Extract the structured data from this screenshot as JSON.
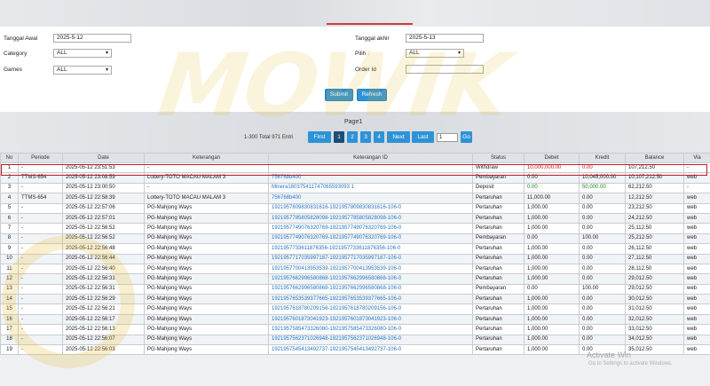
{
  "filters": {
    "tanggal_awal_label": "Tanggal Awal",
    "tanggal_awal_value": "2025-5-12",
    "tanggal_akhir_label": "Tanggal akhir",
    "tanggal_akhir_value": "2025-5-13",
    "category_label": "Category",
    "category_value": "ALL",
    "pilih_label": "Pilih :",
    "pilih_value": "ALL",
    "games_label": "Games",
    "games_value": "ALL",
    "order_id_label": "Order Id",
    "order_id_value": "",
    "submit_label": "Submit",
    "refresh_label": "Refresh"
  },
  "pager": {
    "page_title": "Page1",
    "total_text": "1-300 Total 971 Entri",
    "first_label": "First",
    "pages": [
      "1",
      "2",
      "3",
      "4"
    ],
    "next_label": "Next",
    "last_label": "Last",
    "goto_value": "1",
    "go_label": "Go"
  },
  "table": {
    "headers": [
      "No",
      "Periode",
      "Date",
      "Keterangan",
      "Keterangan ID",
      "Status",
      "Debet",
      "Kredit",
      "Balance",
      "Via"
    ],
    "rows": [
      [
        "1",
        "-",
        "2025-05-12 23:51:53",
        "-",
        "",
        "Withdraw",
        "10,000,000.00",
        "0.00",
        "107,212.50",
        "-"
      ],
      [
        "2",
        "TTMS-654",
        "2025-05-12 23:08:59",
        "Lottery-TOTO MACAU MALAM 3",
        "756768b400",
        "Pembayaran",
        "0.00",
        "10,045,000.00",
        "10,107,212.50",
        "web"
      ],
      [
        "3",
        "-",
        "2025-05-12 23:00:50",
        "-",
        "Minera180375411747065593093 1",
        "Deposit",
        "0.00",
        "50,000.00",
        "62,212.50",
        "-"
      ],
      [
        "4",
        "TTMS-654",
        "2025-05-12 22:58:39",
        "Lottery-TOTO MACAU MALAM 3",
        "756768b400",
        "Pertaruhan",
        "11,000.00",
        "0.00",
        "12,212.50",
        "web"
      ],
      [
        "5",
        "-",
        "2025-05-12 22:57:06",
        "PG-Mahjong Ways",
        "1921957809830831616-1921957809830831616-106-0",
        "Pertaruhan",
        "1,000.00",
        "0.00",
        "23,212.50",
        "web"
      ],
      [
        "6",
        "-",
        "2025-05-12 22:57:01",
        "PG-Mahjong Ways",
        "1921957785805828098-1921957785805828098-106-0",
        "Pertaruhan",
        "1,000.00",
        "0.00",
        "24,212.50",
        "web"
      ],
      [
        "7",
        "-",
        "2025-05-12 22:56:52",
        "PG-Mahjong Ways",
        "1921957749076320769-1921957749076320769-106-0",
        "Pertaruhan",
        "1,000.00",
        "0.00",
        "25,112.50",
        "web"
      ],
      [
        "8",
        "-",
        "2025-05-12 22:56:52",
        "PG-Mahjong Ways",
        "1921957749076320769-1921957749076320769-106-0",
        "Pembayaran",
        "0.00",
        "100.00",
        "25,212.50",
        "web"
      ],
      [
        "9",
        "-",
        "2025-05-12 22:56:48",
        "PG-Mahjong Ways",
        "1921957733611876356-1921957733611876356-106-0",
        "Pertaruhan",
        "1,000.00",
        "0.00",
        "26,112.50",
        "web"
      ],
      [
        "10",
        "-",
        "2025-05-12 22:56:44",
        "PG-Mahjong Ways",
        "1921957717035997187-1921957717035997187-106-0",
        "Pertaruhan",
        "1,000.00",
        "0.00",
        "27,112.50",
        "web"
      ],
      [
        "11",
        "-",
        "2025-05-12 22:56:40",
        "PG-Mahjong Ways",
        "1921957700413953539-1921957700413953539-106-0",
        "Pertaruhan",
        "1,000.00",
        "0.00",
        "28,112.50",
        "web"
      ],
      [
        "12",
        "-",
        "2025-05-12 22:56:31",
        "PG-Mahjong Ways",
        "1921957662996580868-1921957662996580868-106-0",
        "Pertaruhan",
        "1,000.00",
        "0.00",
        "29,012.50",
        "web"
      ],
      [
        "13",
        "-",
        "2025-05-12 22:56:31",
        "PG-Mahjong Ways",
        "1921957662996580868-1921957662996580868-106-0",
        "Pembayaran",
        "0.00",
        "100.00",
        "29,012.50",
        "web"
      ],
      [
        "14",
        "-",
        "2025-05-12 22:56:29",
        "PG-Mahjong Ways",
        "1921957653539377665-1921957653539377665-106-0",
        "Pertaruhan",
        "1,000.00",
        "0.00",
        "30,012.50",
        "web"
      ],
      [
        "15",
        "-",
        "2025-05-12 22:56:21",
        "PG-Mahjong Ways",
        "1921957618780209156-1921957618780209156-106-0",
        "Pertaruhan",
        "1,000.00",
        "0.00",
        "31,012.50",
        "web"
      ],
      [
        "16",
        "-",
        "2025-05-12 22:56:17",
        "PG-Mahjong Ways",
        "1921957601873041923-1921957601873041923-106-0",
        "Pertaruhan",
        "1,000.00",
        "0.00",
        "32,012.50",
        "web"
      ],
      [
        "17",
        "-",
        "2025-05-12 22:56:13",
        "PG-Mahjong Ways",
        "1921957585473326080-1921957585473326080-106-0",
        "Pertaruhan",
        "1,000.00",
        "0.00",
        "33,012.50",
        "web"
      ],
      [
        "18",
        "-",
        "2025-05-12 22:56:07",
        "PG-Mahjong Ways",
        "1921957562371026948-1921957562371026948-106-0",
        "Pertaruhan",
        "1,000.00",
        "0.00",
        "34,012.50",
        "web"
      ],
      [
        "19",
        "-",
        "2025-05-12 22:56:03",
        "PG-Mahjong Ways",
        "1921957545413492737-1921957545413492737-106-0",
        "Pertaruhan",
        "1,000.00",
        "0.00",
        "35,012.50",
        "web"
      ]
    ]
  },
  "watermark_text": "MOWIK",
  "activate_windows": {
    "title": "Activate Win",
    "subtitle": "Go to Settings to activate Windows."
  },
  "colors": {
    "accent": "#2e92d6",
    "highlight_border": "#c41c25",
    "debit_red": "#d4141b",
    "credit_green": "#138a1c",
    "link": "#2477c7"
  }
}
